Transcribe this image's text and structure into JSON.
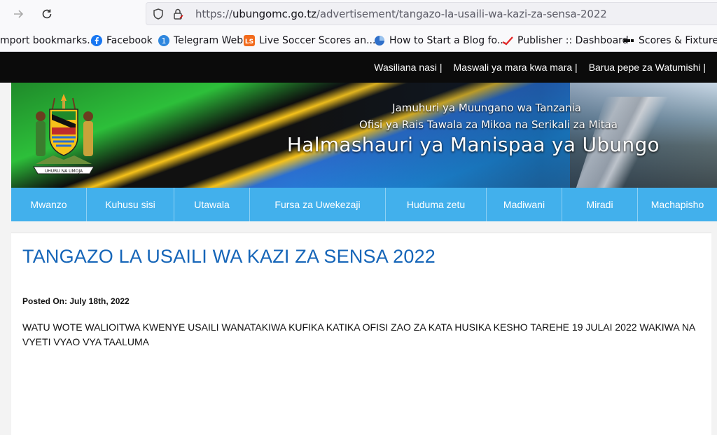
{
  "browser": {
    "url_prefix": "https://",
    "url_host": "ubungomc.go.tz",
    "url_path": "/advertisement/tangazo-la-usaili-wa-kazi-za-sensa-2022",
    "bookmarks": [
      {
        "label": "mport bookmarks...",
        "icon": "import-icon"
      },
      {
        "label": "Facebook",
        "icon": "facebook-icon"
      },
      {
        "label": "Telegram Web",
        "icon": "telegram-icon"
      },
      {
        "label": "Live Soccer Scores an...",
        "icon": "livescore-icon"
      },
      {
        "label": "How to Start a Blog fo...",
        "icon": "blog-icon"
      },
      {
        "label": "Publisher :: Dashboard",
        "icon": "publisher-icon"
      },
      {
        "label": "Scores & Fixtures -",
        "icon": "scores-icon"
      }
    ]
  },
  "topbar": {
    "links": [
      "Wasiliana nasi |",
      "Maswali ya mara kwa mara |",
      "Barua pepe za Watumishi |"
    ]
  },
  "banner": {
    "line1": "Jamuhuri ya Muungano wa Tanzania",
    "line2": "Ofisi ya Rais Tawala za Mikoa na Serikali za Mitaa",
    "title": "Halmashauri ya Manispaa ya Ubungo",
    "crest_motto": "UHURU NA UMOJA"
  },
  "menu": {
    "items": [
      "Mwanzo",
      "Kuhusu sisi",
      "Utawala",
      "Fursa za Uwekezaji",
      "Huduma zetu",
      "Madiwani",
      "Miradi",
      "Machapisho"
    ]
  },
  "post": {
    "title": "TANGAZO LA USAILI WA KAZI ZA SENSA 2022",
    "posted_on": "Posted On: July 18th, 2022",
    "body": "WATU WOTE WALIOITWA KWENYE USAILI WANATAKIWA KUFIKA KATIKA OFISI ZAO ZA KATA HUSIKA KESHO TAREHE 19 JULAI 2022 WAKIWA NA VYETI VYAO VYA TAALUMA"
  },
  "colors": {
    "menu_bg": "#42b0ec",
    "title_blue": "#1565b8",
    "topbar_bg": "#0b0b0b"
  }
}
